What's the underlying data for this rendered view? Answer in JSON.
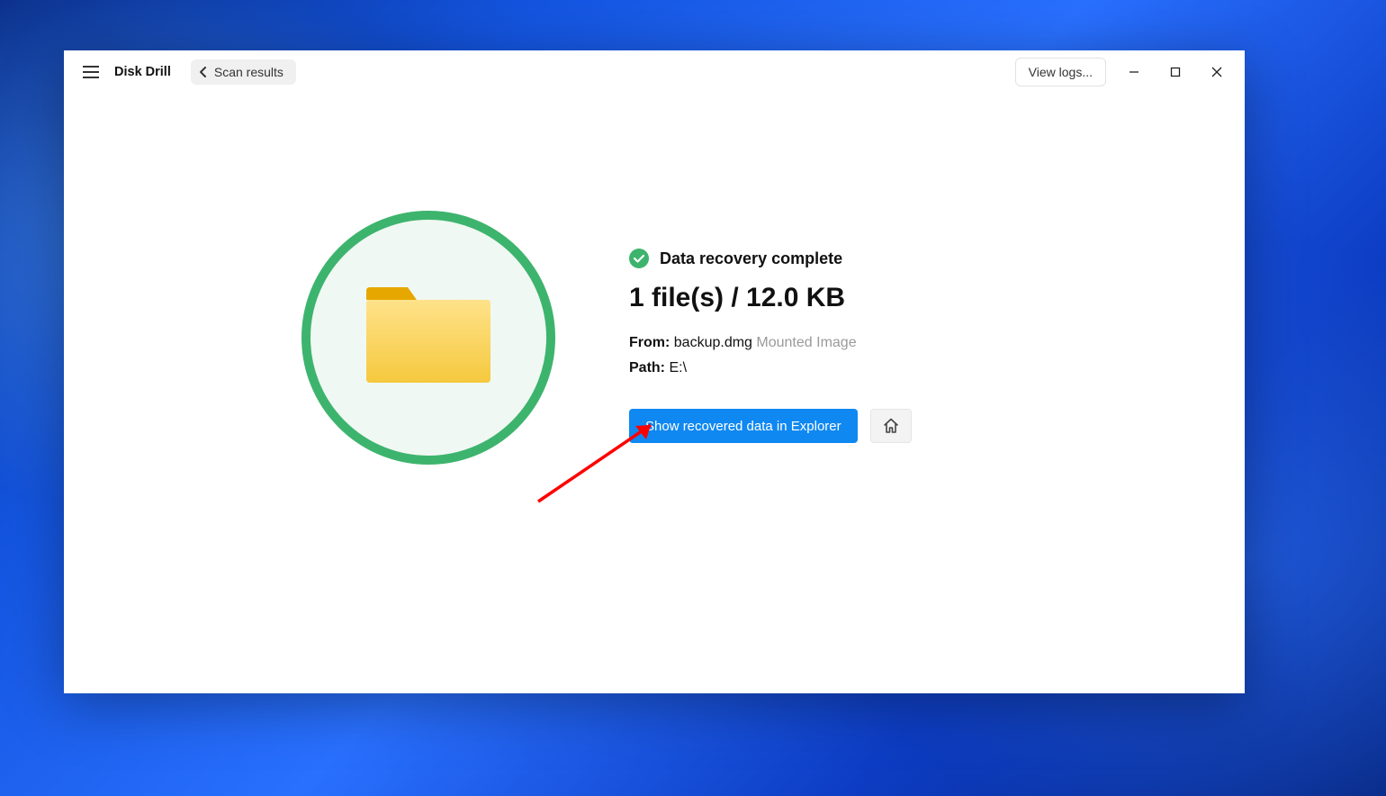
{
  "app": {
    "title": "Disk Drill",
    "breadcrumb_label": "Scan results",
    "view_logs_btn": "View logs..."
  },
  "result": {
    "status_text": "Data recovery complete",
    "summary": "1 file(s) / 12.0 KB",
    "from_label": "From:",
    "from_value": "backup.dmg",
    "from_suffix": "Mounted Image",
    "path_label": "Path:",
    "path_value": "E:\\",
    "show_btn": "Show recovered data in Explorer"
  },
  "colors": {
    "accent_green": "#3db46d",
    "primary_blue": "#0f88f2"
  }
}
